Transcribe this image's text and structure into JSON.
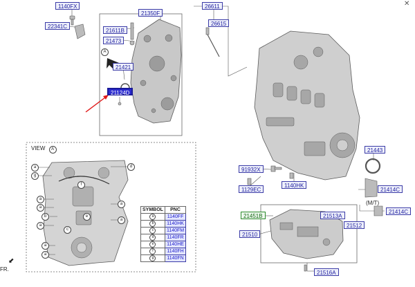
{
  "labels": {
    "p1140FX": "1140FX",
    "p21350F": "21350F",
    "p22341C": "22341C",
    "p21611B": "21611B",
    "p21473": "21473",
    "p21421": "21421",
    "p21124D": "21124D",
    "p26611": "26611",
    "p26615": "26615",
    "p21443": "21443",
    "p91932X": "91932X",
    "p1129EC": "1129EC",
    "p1140HK": "1140HK",
    "p21414C_a": "21414C",
    "p21414C_b": "21414C",
    "p21451B": "21451B",
    "p21513A": "21513A",
    "p21512": "21512",
    "p21510": "21510",
    "p21516A": "21516A",
    "mt": "(M/T)",
    "view": "VIEW",
    "view_letter": "A",
    "arrow_letter": "A",
    "fr": "FR."
  },
  "symbol_table": {
    "headers": [
      "SYMBOL",
      "PNC"
    ],
    "rows": [
      {
        "symbol": "a",
        "pnc": "1140FF"
      },
      {
        "symbol": "b",
        "pnc": "1140HK"
      },
      {
        "symbol": "c",
        "pnc": "1140FM"
      },
      {
        "symbol": "d",
        "pnc": "1140FR"
      },
      {
        "symbol": "e",
        "pnc": "1140HE"
      },
      {
        "symbol": "f",
        "pnc": "1140FH"
      },
      {
        "symbol": "g",
        "pnc": "1140FN"
      }
    ]
  },
  "callout_symbols": [
    "a",
    "b",
    "c",
    "d",
    "e",
    "f",
    "g"
  ],
  "colors": {
    "highlight": "#e01818",
    "link_text": "#2020a0",
    "part_fill": "#c9c9c9",
    "part_stroke": "#5a5a5a"
  }
}
